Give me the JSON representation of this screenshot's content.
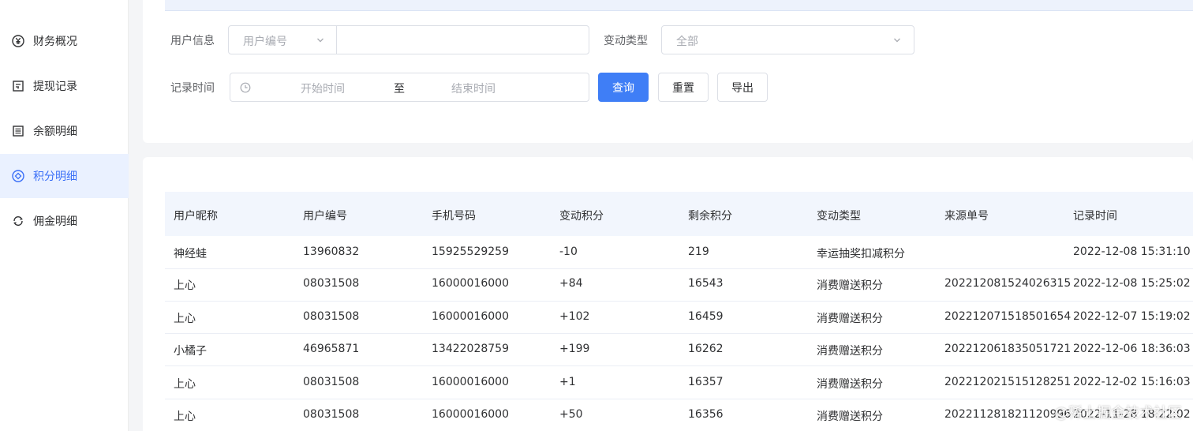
{
  "sidebar": {
    "items": [
      {
        "label": "财务概况",
        "icon": "yen-circle-icon"
      },
      {
        "label": "提现记录",
        "icon": "withdraw-record-icon"
      },
      {
        "label": "余额明细",
        "icon": "list-detail-icon"
      },
      {
        "label": "积分明细",
        "icon": "points-icon",
        "active": true
      },
      {
        "label": "佣金明细",
        "icon": "commission-icon"
      }
    ]
  },
  "filters": {
    "user_info_label": "用户信息",
    "user_field_select": "用户编号",
    "user_keyword_value": "",
    "change_type_label": "变动类型",
    "change_type_value": "全部",
    "record_time_label": "记录时间",
    "start_placeholder": "开始时间",
    "range_separator": "至",
    "end_placeholder": "结束时间",
    "search_button": "查询",
    "reset_button": "重置",
    "export_button": "导出"
  },
  "table": {
    "headers": [
      "用户昵称",
      "用户编号",
      "手机号码",
      "变动积分",
      "剩余积分",
      "变动类型",
      "来源单号",
      "记录时间"
    ],
    "rows": [
      [
        "神经蛙",
        "13960832",
        "15925529259",
        "-10",
        "219",
        "幸运抽奖扣减积分",
        "",
        "2022-12-08 15:31:10"
      ],
      [
        "上心",
        "08031508",
        "16000016000",
        "+84",
        "16543",
        "消费赠送积分",
        "202212081524026315",
        "2022-12-08 15:25:02"
      ],
      [
        "上心",
        "08031508",
        "16000016000",
        "+102",
        "16459",
        "消费赠送积分",
        "202212071518501654",
        "2022-12-07 15:19:02"
      ],
      [
        "小橘子",
        "46965871",
        "13422028759",
        "+199",
        "16262",
        "消费赠送积分",
        "202212061835051721",
        "2022-12-06 18:36:03"
      ],
      [
        "上心",
        "08031508",
        "16000016000",
        "+1",
        "16357",
        "消费赠送积分",
        "202212021515128251",
        "2022-12-02 15:16:03"
      ],
      [
        "上心",
        "08031508",
        "16000016000",
        "+50",
        "16356",
        "消费赠送积分",
        "202211281821120996",
        "2022-11-28 18:22:02"
      ]
    ]
  },
  "watermark": "@稀土掘金技术社区",
  "colors": {
    "primary": "#3f7ef6",
    "active_bg": "#eaf1ff",
    "active_text": "#3a6ff7",
    "header_bg": "#f2f6fd"
  }
}
